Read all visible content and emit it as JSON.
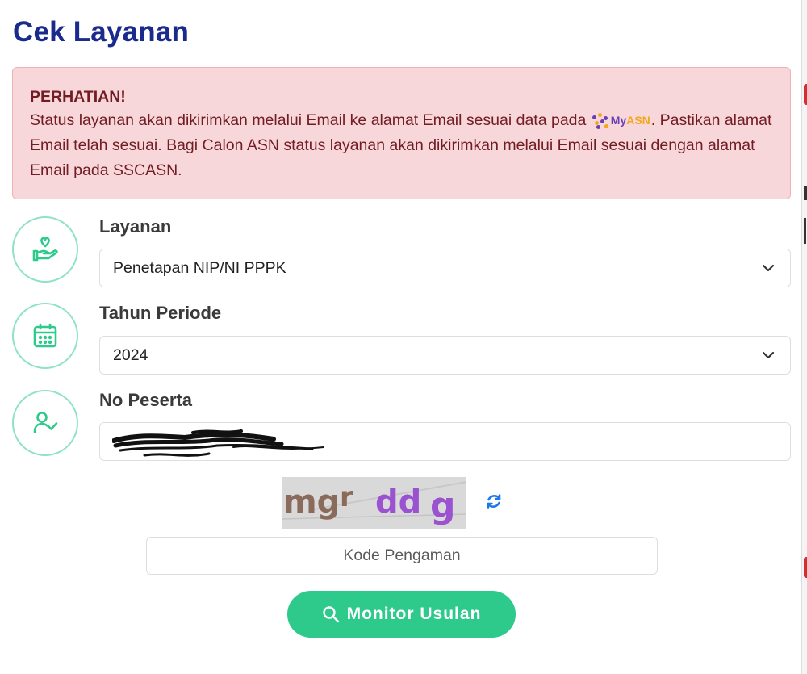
{
  "page": {
    "title": "Cek Layanan"
  },
  "alert": {
    "heading": "PERHATIAN!",
    "text_before_logo": "Status layanan akan dikirimkan melalui Email ke alamat Email sesuai data pada",
    "logo_text": "MyASN",
    "text_after_logo": ". Pastikan alamat Email telah sesuai. Bagi Calon ASN status layanan akan dikirimkan melalui Email sesuai dengan alamat Email pada SSCASN.",
    "color_bg": "#f8d7da",
    "color_text": "#721c24"
  },
  "form": {
    "layanan": {
      "label": "Layanan",
      "selected": "Penetapan NIP/NI PPPK",
      "icon": "hand-heart-icon"
    },
    "tahun": {
      "label": "Tahun Periode",
      "selected": "2024",
      "icon": "calendar-icon"
    },
    "peserta": {
      "label": "No Peserta",
      "value_redacted": true,
      "icon": "user-check-icon"
    },
    "captcha": {
      "text": "mgr ddg",
      "refresh_icon": "refresh-icon"
    },
    "kode": {
      "placeholder": "Kode Pengaman"
    },
    "submit": {
      "label": "Monitor Usulan",
      "icon": "search-icon"
    }
  },
  "colors": {
    "title": "#1a2b8c",
    "accent": "#2dca8c",
    "icon_ring": "#8fe3c4"
  }
}
